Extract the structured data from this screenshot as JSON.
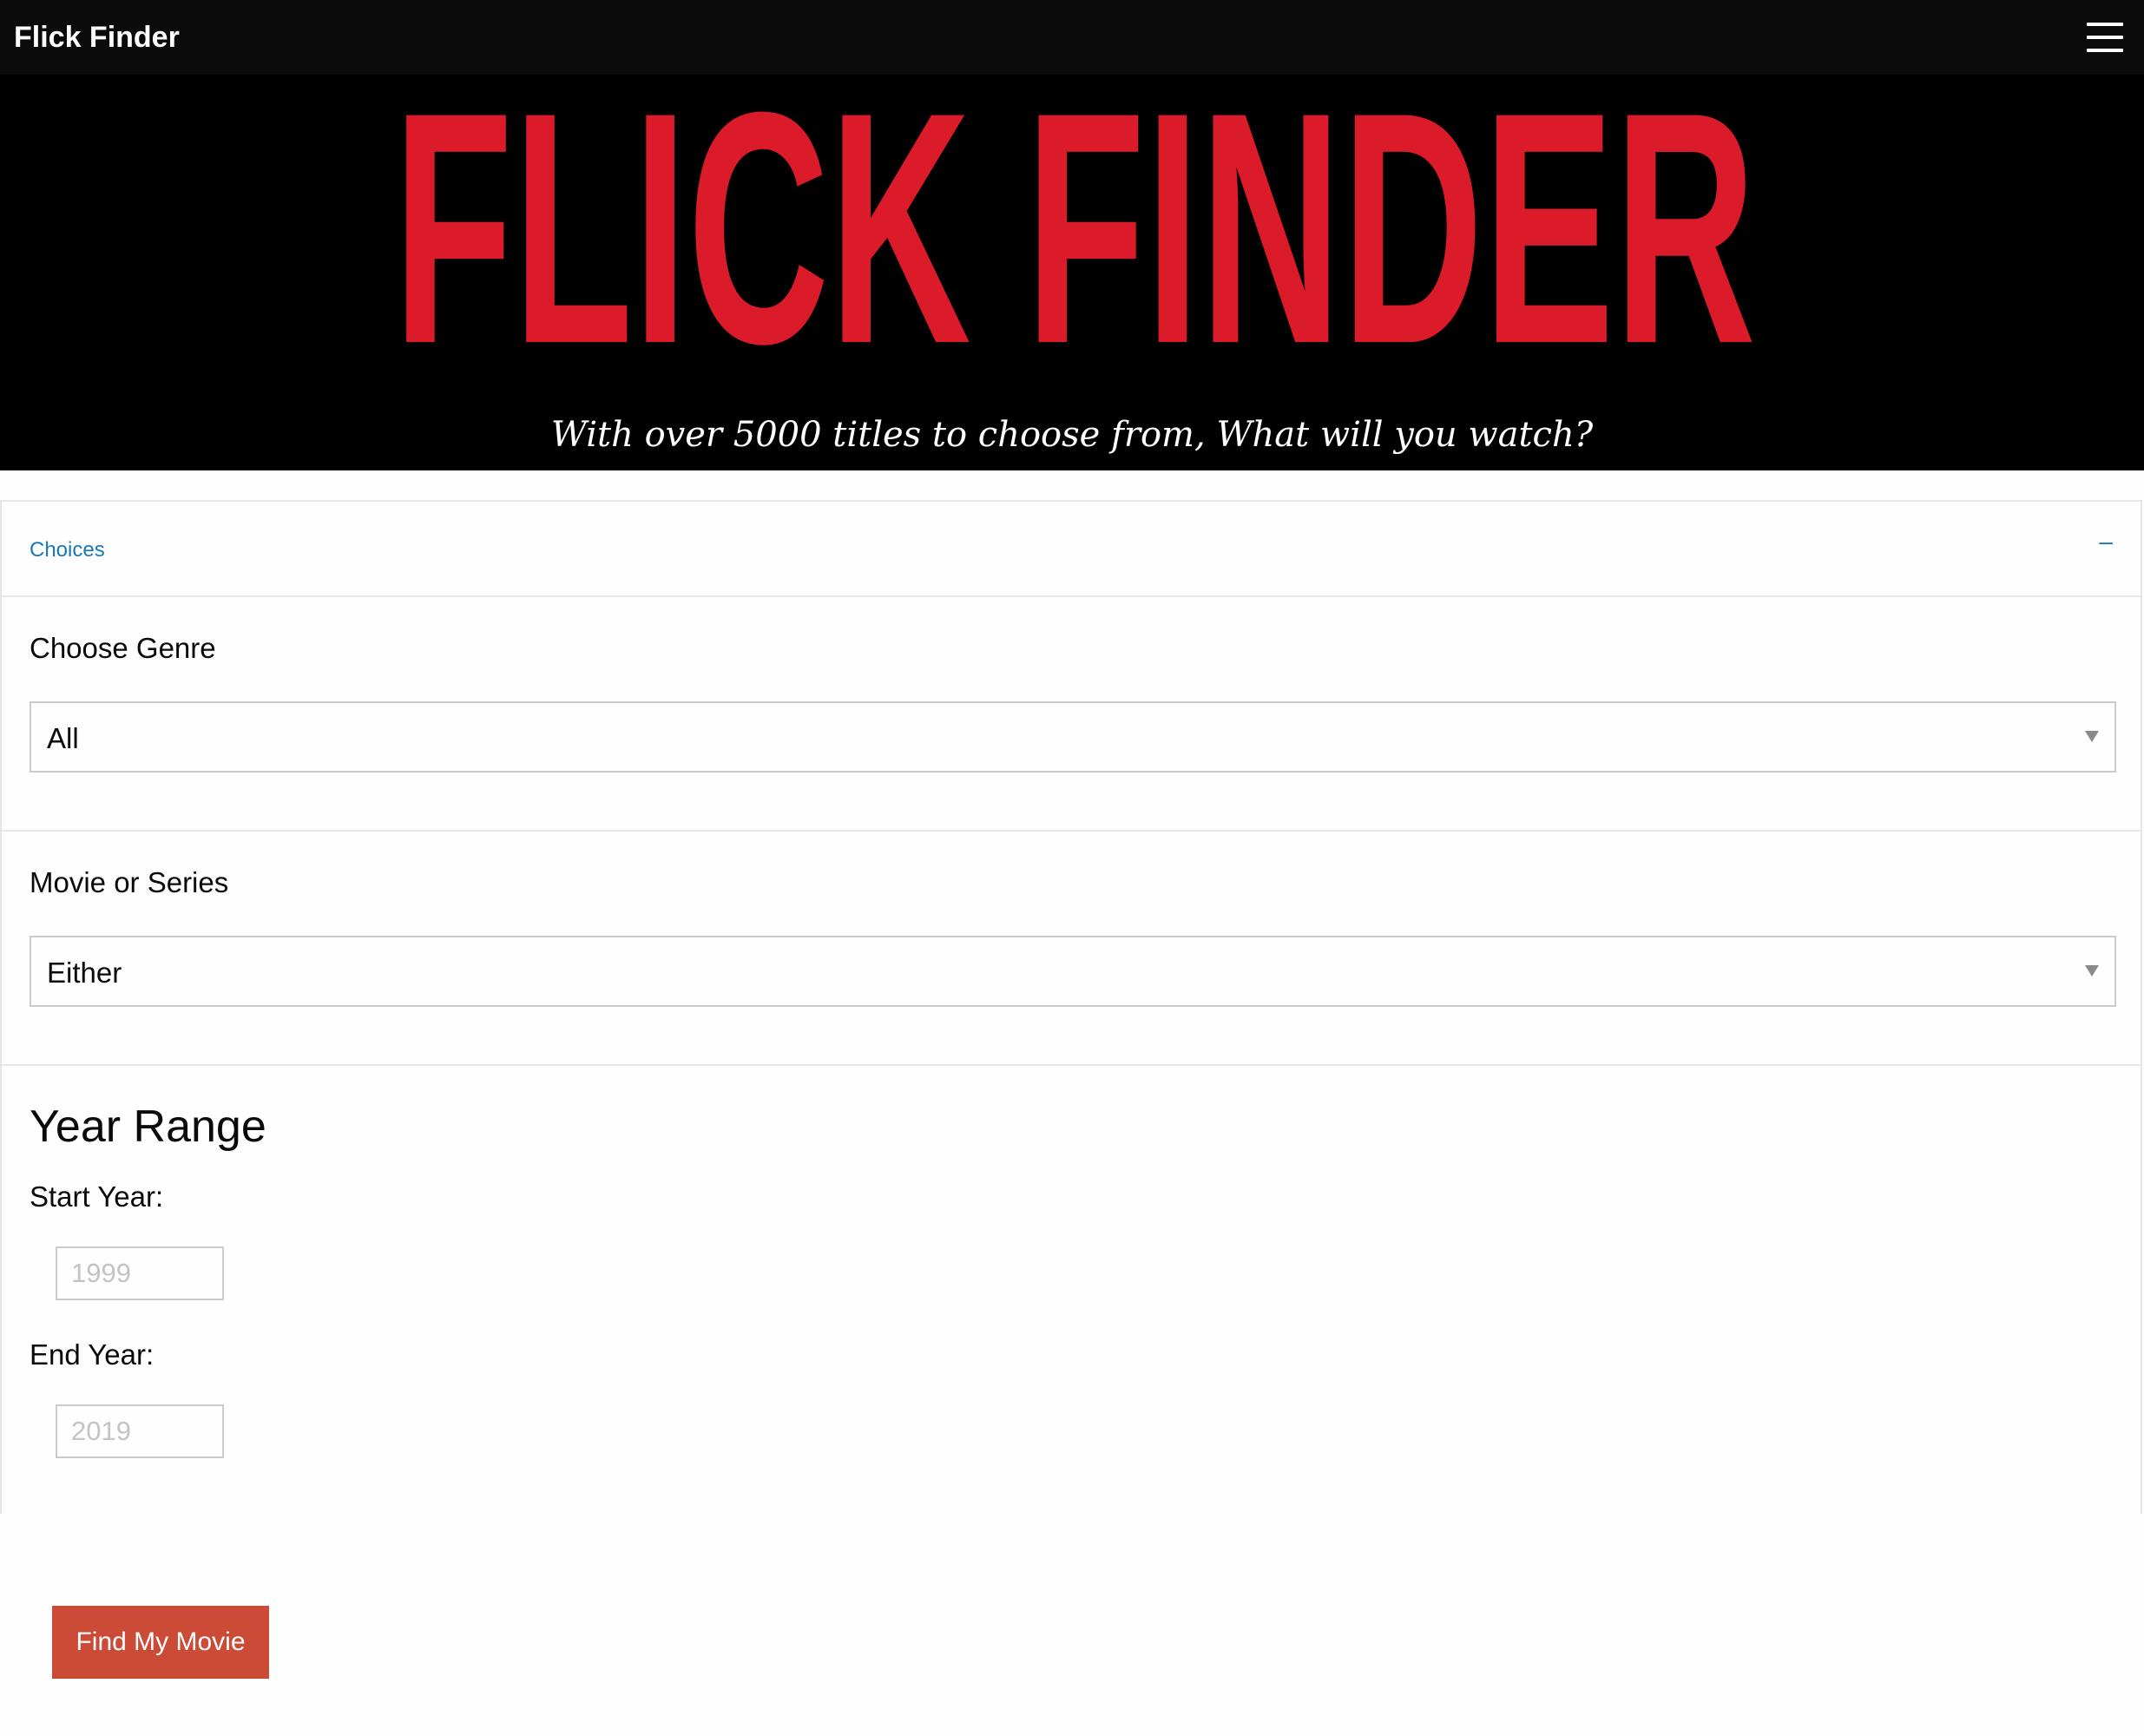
{
  "navbar": {
    "title": "Flick Finder",
    "menu_icon": "hamburger-icon"
  },
  "hero": {
    "logo_text": "FLICK FINDER",
    "logo_color": "#db1a2a",
    "tagline": "With over 5000 titles to choose from, What will you watch?"
  },
  "accordion": {
    "title": "Choices",
    "toggle": "–",
    "accent_color": "#1779ba"
  },
  "genre": {
    "label": "Choose Genre",
    "selected": "All"
  },
  "type": {
    "label": "Movie or Series",
    "selected": "Either"
  },
  "year_range": {
    "heading": "Year Range",
    "start_label": "Start Year:",
    "start_placeholder": "1999",
    "end_label": "End Year:",
    "end_placeholder": "2019"
  },
  "submit": {
    "label": "Find My Movie",
    "color": "#cc4b37"
  }
}
